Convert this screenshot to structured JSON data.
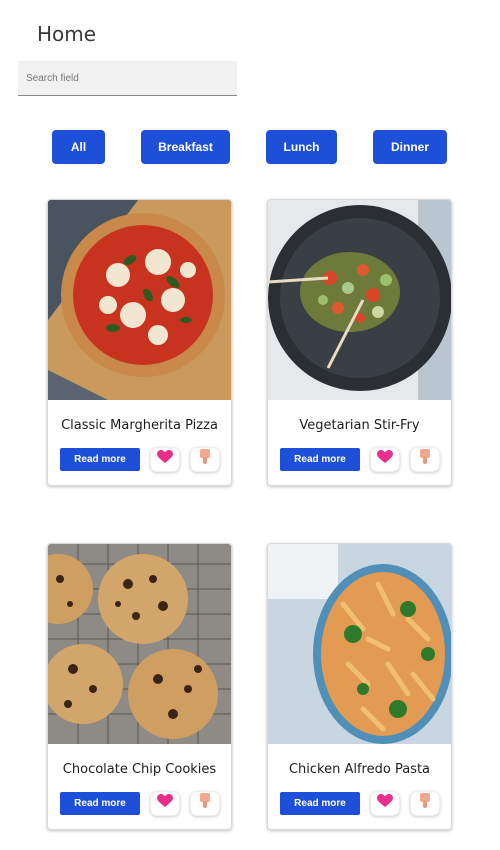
{
  "header": {
    "title": "Home"
  },
  "search": {
    "placeholder": "Search field",
    "value": ""
  },
  "filters": [
    "All",
    "Breakfast",
    "Lunch",
    "Dinner"
  ],
  "recipes": [
    {
      "title": "Classic Margherita Pizza",
      "read_more": "Read more",
      "like_icon": "heart-icon",
      "dislike_icon": "thumbs-down-icon"
    },
    {
      "title": "Vegetarian Stir-Fry",
      "read_more": "Read more",
      "like_icon": "heart-icon",
      "dislike_icon": "thumbs-down-icon"
    },
    {
      "title": "Chocolate Chip Cookies",
      "read_more": "Read more",
      "like_icon": "heart-icon",
      "dislike_icon": "thumbs-down-icon"
    },
    {
      "title": "Chicken Alfredo Pasta",
      "read_more": "Read more",
      "like_icon": "heart-icon",
      "dislike_icon": "thumbs-down-icon"
    }
  ],
  "colors": {
    "accent": "#1e4fd8",
    "heart": "#e8308a",
    "thumb": "#f0a98c"
  }
}
